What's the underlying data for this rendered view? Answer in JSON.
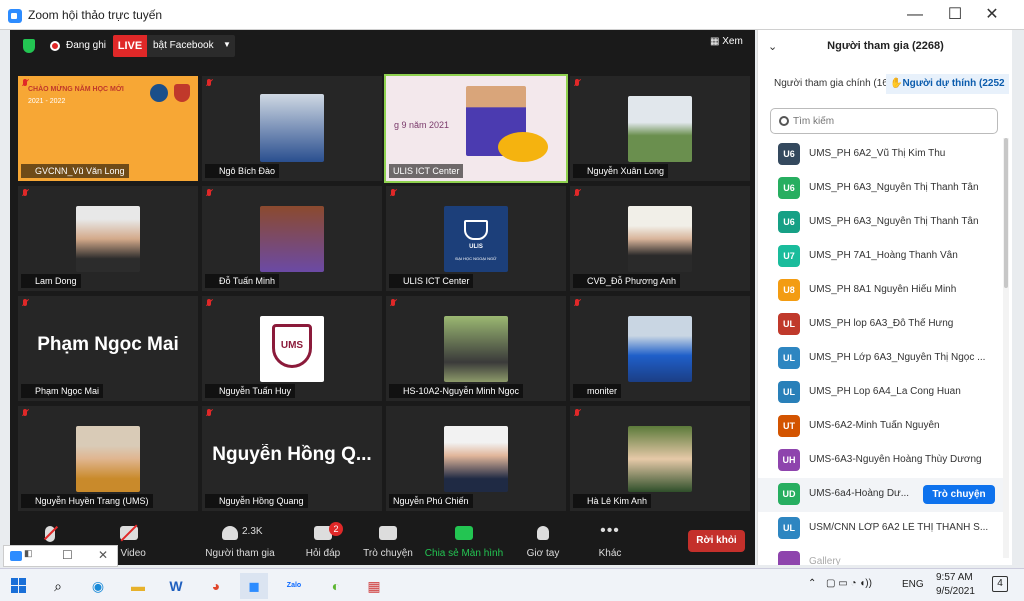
{
  "window": {
    "title": "Zoom hội thảo trực tuyến",
    "min": "—",
    "max": "☐",
    "close": "✕"
  },
  "topbar": {
    "recording": "Đang ghi",
    "live": "LIVE",
    "live_target": "bật Facebook",
    "view": "Xem"
  },
  "banner": {
    "line1": "CHÀO MỪNG NĂM HỌC MỚI",
    "line2": "2021 - 2022",
    "slide_date": "g 9 năm 2021"
  },
  "tiles": [
    {
      "name": "GVCNN_Vũ Văn Long"
    },
    {
      "name": "Ngô Bích Đào"
    },
    {
      "name": "ULIS ICT Center"
    },
    {
      "name": "Nguyễn Xuân Long"
    },
    {
      "name": "Lam Dong"
    },
    {
      "name": "Đỗ Tuấn Minh"
    },
    {
      "name": "ULIS ICT Center"
    },
    {
      "name": "CVĐ_Đỗ Phương Anh"
    },
    {
      "name": "Phạm Ngọc Mai",
      "big": "Phạm Ngọc Mai"
    },
    {
      "name": "Nguyễn Tuấn Huy"
    },
    {
      "name": "HS-10A2-Nguyễn Minh Ngọc"
    },
    {
      "name": "moniter"
    },
    {
      "name": "Nguyễn Huyền Trang (UMS)"
    },
    {
      "name": "Nguyễn Hồng Quang",
      "big": "Nguyễn Hồng Q..."
    },
    {
      "name": "Nguyễn Phú Chiến"
    },
    {
      "name": "Hà Lê Kim Anh"
    }
  ],
  "logos": {
    "ulis_top": "ULIS",
    "ulis_bottom": "ĐẠI HỌC NGOẠI NGỮ",
    "ums": "UMS"
  },
  "controls": {
    "mic": "",
    "video": "u Video",
    "participants": "Người tham gia",
    "participants_count": "2.3K",
    "qa": "Hỏi đáp",
    "qa_badge": "2",
    "chat": "Trò chuyện",
    "share": "Chia sẻ Màn hình",
    "raise": "Giơ tay",
    "more": "Khác",
    "leave": "Rời khỏi"
  },
  "panel": {
    "title": "Người tham gia (2268)",
    "tab_main": "Người tham gia chính (16)",
    "tab_attendee": "Người dự thính (2252",
    "search_placeholder": "Tìm kiếm",
    "chat_button": "Trò chuyện",
    "rows": [
      {
        "initials": "U6",
        "color": "#34495e",
        "name": "UMS_PH 6A2_Vũ Thị Kim Thu"
      },
      {
        "initials": "U6",
        "color": "#27ae60",
        "name": "UMS_PH 6A3_Nguyễn Thị Thanh Tân"
      },
      {
        "initials": "U6",
        "color": "#16a085",
        "name": "UMS_PH 6A3_Nguyễn Thị Thanh Tân"
      },
      {
        "initials": "U7",
        "color": "#1abc9c",
        "name": "UMS_PH 7A1_Hoàng Thanh Vân"
      },
      {
        "initials": "U8",
        "color": "#f39c12",
        "name": "UMS_PH 8A1 Nguyễn Hiếu Minh"
      },
      {
        "initials": "UL",
        "color": "#c0392b",
        "name": "UMS_PH lop 6A3_Đỗ Thế Hưng"
      },
      {
        "initials": "UL",
        "color": "#2e86c1",
        "name": "UMS_PH Lớp 6A3_Nguyễn Thị Ngọc ..."
      },
      {
        "initials": "UL",
        "color": "#2980b9",
        "name": "UMS_PH Lop 6A4_La Cong Huan"
      },
      {
        "initials": "UT",
        "color": "#d35400",
        "name": "UMS-6A2-Minh Tuấn Nguyễn"
      },
      {
        "initials": "UH",
        "color": "#8e44ad",
        "name": "UMS-6A3-Nguyễn Hoàng Thùy Dương"
      },
      {
        "initials": "UD",
        "color": "#27ae60",
        "name": "UMS-6a4-Hoàng Dư..."
      },
      {
        "initials": "UL",
        "color": "#2e86c1",
        "name": "USM/CNN LỚP 6A2 LÊ THỊ THANH S..."
      },
      {
        "initials": "",
        "color": "#8e44ad",
        "name": "Gallery"
      }
    ]
  },
  "taskbar": {
    "lang": "ENG",
    "time": "9:57 AM",
    "date": "9/5/2021",
    "notif_count": "4",
    "zalo": "Zalo"
  }
}
